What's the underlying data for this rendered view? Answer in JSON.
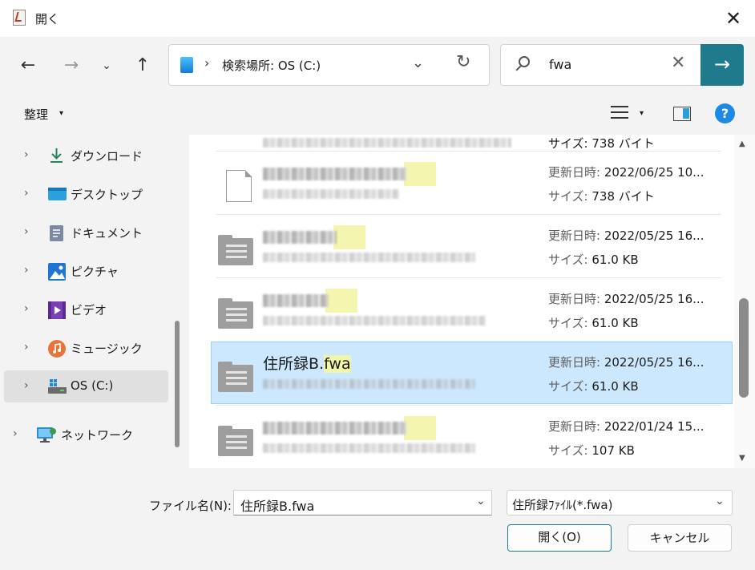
{
  "window": {
    "title": "開く",
    "close_glyph": "✕"
  },
  "nav": {
    "back": "←",
    "forward": "→",
    "recent": "⌄",
    "up": "↑",
    "address": {
      "chevron": "›",
      "text": "検索場所: OS (C:)",
      "dropdown": "⌄",
      "refresh": "↻"
    },
    "search": {
      "value": "fwa",
      "clear": "✕",
      "go": "→"
    }
  },
  "command": {
    "organize": "整理",
    "caret": "▾"
  },
  "sidebar": {
    "items": [
      {
        "label": "ダウンロード",
        "icon": "download-icon"
      },
      {
        "label": "デスクトップ",
        "icon": "desktop-icon"
      },
      {
        "label": "ドキュメント",
        "icon": "documents-icon"
      },
      {
        "label": "ピクチャ",
        "icon": "pictures-icon"
      },
      {
        "label": "ビデオ",
        "icon": "videos-icon"
      },
      {
        "label": "ミュージック",
        "icon": "music-icon"
      },
      {
        "label": "OS (C:)",
        "icon": "drive-icon"
      },
      {
        "label": "ネットワーク",
        "icon": "network-icon"
      }
    ],
    "chevron": "›"
  },
  "files": {
    "date_label": "更新日時:",
    "size_label": "サイズ:",
    "partial_top": {
      "size": "738 バイト"
    },
    "rows": [
      {
        "date": "2022/06/25 10...",
        "size": "738 バイト"
      },
      {
        "date": "2022/05/25 16...",
        "size": "61.0 KB"
      },
      {
        "date": "2022/05/25 16...",
        "size": "61.0 KB"
      },
      {
        "name_base": "住所録B.",
        "name_ext": "fwa",
        "date": "2022/05/25 16...",
        "size": "61.0 KB"
      },
      {
        "date": "2022/01/24 15...",
        "size": "107 KB"
      }
    ]
  },
  "footer": {
    "filename_label": "ファイル名(N):",
    "filename_value": "住所録B.fwa",
    "filetype_value": "住所録ﾌｧｲﾙ(*.fwa)",
    "open_label": "開く(O)",
    "cancel_label": "キャンセル",
    "dropdown": "⌄"
  },
  "colors": {
    "accent": "#1f7a8c",
    "selection": "#cce8ff",
    "highlight": "#f2f6a8"
  }
}
